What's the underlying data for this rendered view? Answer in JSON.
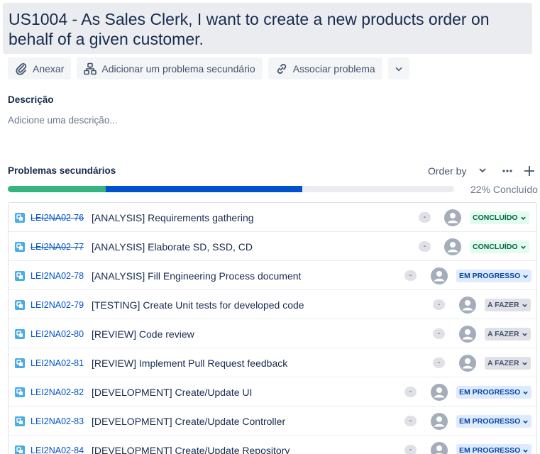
{
  "issue": {
    "title": "US1004 - As Sales Clerk, I want to create a new products order on behalf of a given customer."
  },
  "toolbar": {
    "attach_label": "Anexar",
    "add_child_label": "Adicionar um problema secundário",
    "link_label": "Associar problema"
  },
  "description": {
    "label": "Descrição",
    "placeholder": "Adicione uma descrição..."
  },
  "subtasks": {
    "heading": "Problemas secundários",
    "order_by_label": "Order by",
    "progress_label": "22% Concluído",
    "progress": {
      "done": 0.22,
      "in_progress": 0.44
    },
    "colors": {
      "done": "#36b37e",
      "in_progress": "#0052cc",
      "todo": "#ebecf0"
    },
    "items": [
      {
        "key": "LEI2NA02-76",
        "summary": "[ANALYSIS] Requirements gathering",
        "priority": "-",
        "status": "CONCLUÍDO",
        "status_type": "done"
      },
      {
        "key": "LEI2NA02-77",
        "summary": "[ANALYSIS] Elaborate SD, SSD, CD",
        "priority": "-",
        "status": "CONCLUÍDO",
        "status_type": "done"
      },
      {
        "key": "LEI2NA02-78",
        "summary": "[ANALYSIS] Fill Engineering Process document",
        "priority": "-",
        "status": "EM PROGRESSO",
        "status_type": "prog"
      },
      {
        "key": "LEI2NA02-79",
        "summary": "[TESTING] Create Unit tests for developed code",
        "priority": "-",
        "status": "A FAZER",
        "status_type": "todo"
      },
      {
        "key": "LEI2NA02-80",
        "summary": "[REVIEW] Code review",
        "priority": "-",
        "status": "A FAZER",
        "status_type": "todo"
      },
      {
        "key": "LEI2NA02-81",
        "summary": "[REVIEW] Implement Pull Request feedback",
        "priority": "-",
        "status": "A FAZER",
        "status_type": "todo"
      },
      {
        "key": "LEI2NA02-82",
        "summary": "[DEVELOPMENT] Create/Update UI",
        "priority": "-",
        "status": "EM PROGRESSO",
        "status_type": "prog"
      },
      {
        "key": "LEI2NA02-83",
        "summary": "[DEVELOPMENT] Create/Update Controller",
        "priority": "-",
        "status": "EM PROGRESSO",
        "status_type": "prog"
      },
      {
        "key": "LEI2NA02-84",
        "summary": "[DEVELOPMENT] Create/Update Repository",
        "priority": "-",
        "status": "EM PROGRESSO",
        "status_type": "prog"
      }
    ]
  }
}
